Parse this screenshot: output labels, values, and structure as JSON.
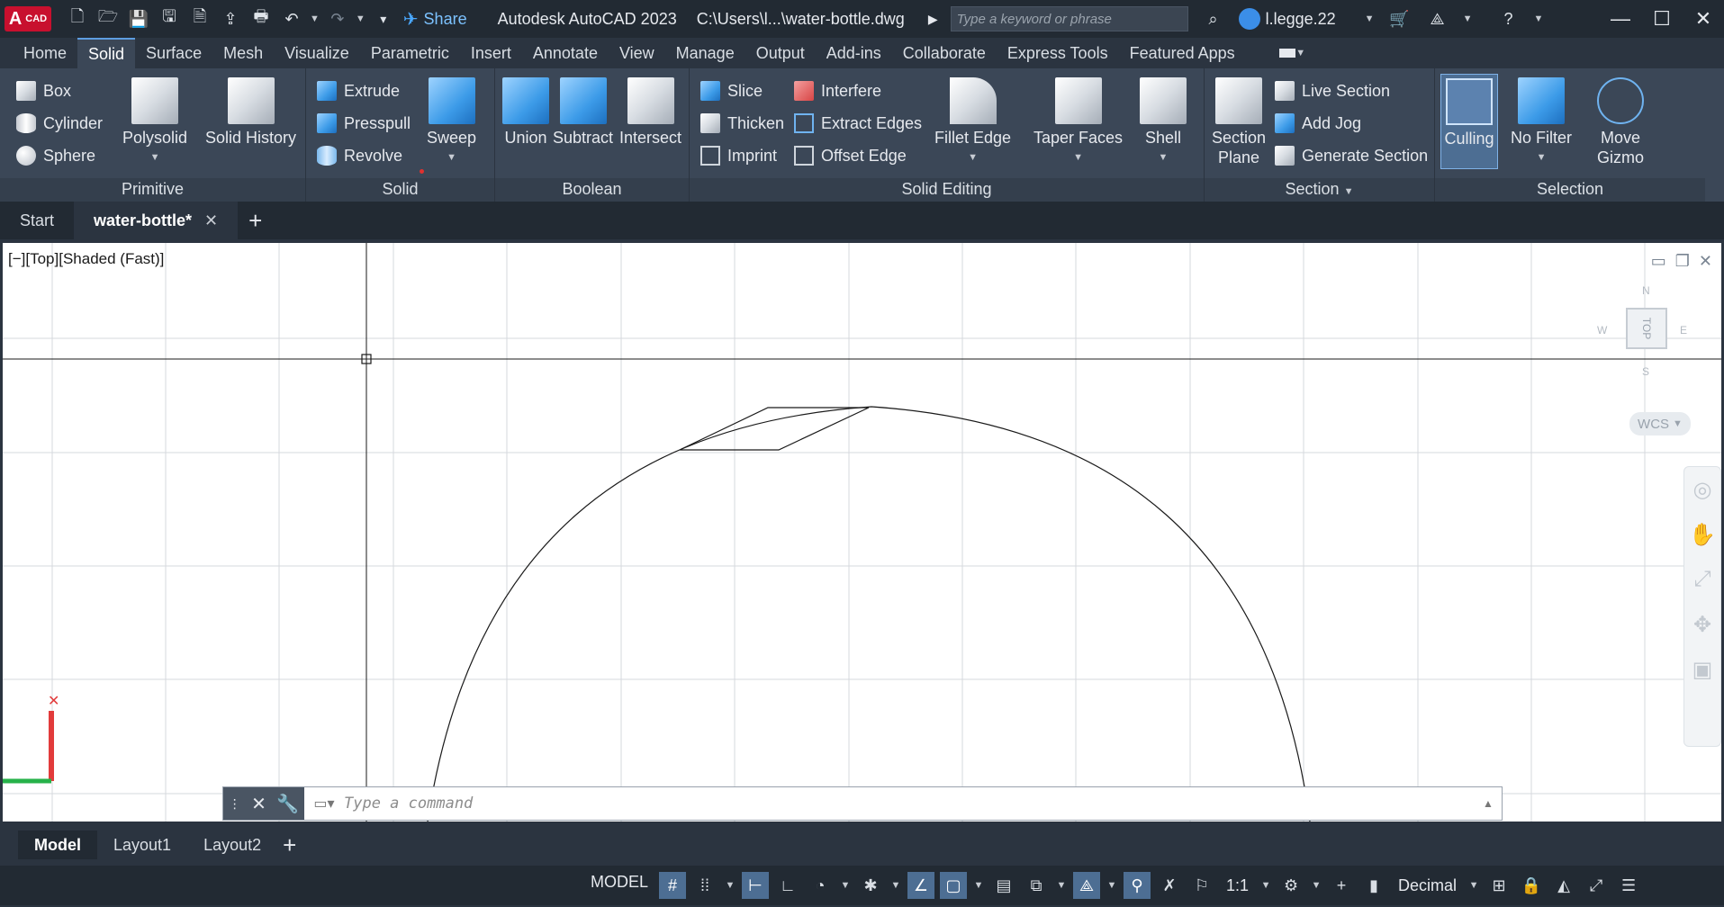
{
  "titlebar": {
    "logo_main": "A",
    "logo_sub": "CAD",
    "share_label": "Share",
    "app_title": "Autodesk AutoCAD 2023",
    "file_path": "C:\\Users\\l...\\water-bottle.dwg",
    "search_placeholder": "Type a keyword or phrase",
    "username": "l.legge.22"
  },
  "ribbon_tabs": [
    "Home",
    "Solid",
    "Surface",
    "Mesh",
    "Visualize",
    "Parametric",
    "Insert",
    "Annotate",
    "View",
    "Manage",
    "Output",
    "Add-ins",
    "Collaborate",
    "Express Tools",
    "Featured Apps"
  ],
  "ribbon_active_tab": "Solid",
  "ribbon": {
    "primitive": {
      "label": "Primitive",
      "box": "Box",
      "cylinder": "Cylinder",
      "sphere": "Sphere",
      "polysolid": "Polysolid",
      "solid_history": "Solid History"
    },
    "solid": {
      "label": "Solid",
      "extrude": "Extrude",
      "presspull": "Presspull",
      "revolve": "Revolve",
      "sweep": "Sweep"
    },
    "boolean": {
      "label": "Boolean",
      "union": "Union",
      "subtract": "Subtract",
      "intersect": "Intersect"
    },
    "solid_editing": {
      "label": "Solid Editing",
      "slice": "Slice",
      "thicken": "Thicken",
      "imprint": "Imprint",
      "interfere": "Interfere",
      "extract_edges": "Extract Edges",
      "offset_edge": "Offset Edge",
      "fillet_edge": "Fillet Edge",
      "taper_faces": "Taper Faces",
      "shell": "Shell"
    },
    "section": {
      "label": "Section",
      "section_plane_1": "Section",
      "section_plane_2": "Plane",
      "live_section": "Live Section",
      "add_jog": "Add Jog",
      "generate_section": "Generate Section"
    },
    "selection": {
      "label": "Selection",
      "culling": "Culling",
      "no_filter": "No Filter",
      "move_gizmo_1": "Move",
      "move_gizmo_2": "Gizmo"
    }
  },
  "file_tabs": {
    "start": "Start",
    "active": "water-bottle*"
  },
  "viewport": {
    "label": "[−][Top][Shaded (Fast)]",
    "viewcube_top": "TOP",
    "viewcube_n": "N",
    "viewcube_s": "S",
    "viewcube_e": "E",
    "viewcube_w": "W",
    "wcs": "WCS"
  },
  "command": {
    "placeholder": "Type a command"
  },
  "layout_tabs": [
    "Model",
    "Layout1",
    "Layout2"
  ],
  "status": {
    "model": "MODEL",
    "scale": "1:1",
    "units": "Decimal"
  }
}
